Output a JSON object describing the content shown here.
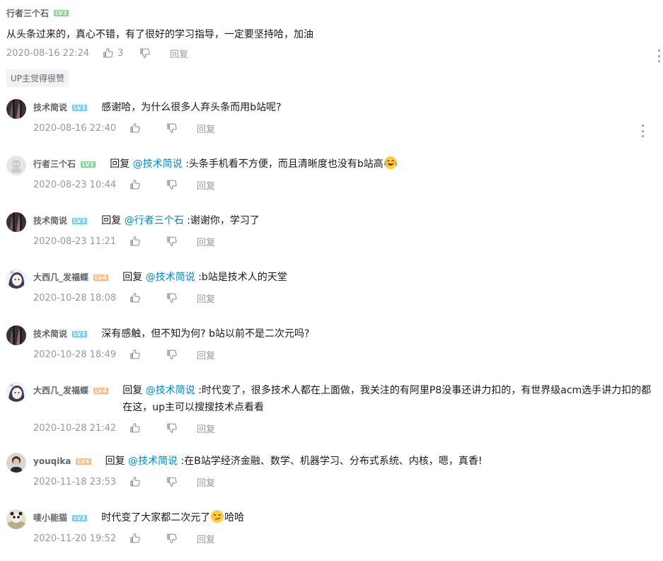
{
  "main_comment": {
    "user": "行者三个石",
    "level": "LV2",
    "text": "从头条过来的，真心不错，有了很好的学习指导，一定要坚持哈，加油",
    "time": "2020-08-16 22:24",
    "likes": "3",
    "reply_label": "回复",
    "tag": "UP主觉得很赞"
  },
  "replies": [
    {
      "user": "技术简说",
      "level": "LV3",
      "prefix": "",
      "at": "",
      "colon": "",
      "text": "感谢哈，为什么很多人弃头条而用b站呢?",
      "time": "2020-08-16 22:40",
      "reply_label": "回复",
      "avatar": "dark"
    },
    {
      "user": "行者三个石",
      "level": "LV2",
      "prefix": "回复",
      "at": "@技术简说",
      "colon": ":",
      "text": "头条手机看不方便，而且清晰度也没有b站高",
      "time": "2020-08-23 10:44",
      "reply_label": "回复",
      "avatar": "default",
      "emoji": "laughing-tears"
    },
    {
      "user": "技术简说",
      "level": "LV3",
      "prefix": "回复",
      "at": "@行者三个石",
      "colon": ":",
      "text": "谢谢你，学习了",
      "time": "2020-08-23 11:21",
      "reply_label": "回复",
      "avatar": "dark"
    },
    {
      "user": "大西几_发福蝶",
      "level": "LV4",
      "prefix": "回复",
      "at": "@技术简说",
      "colon": ":",
      "text": "b站是技术人的天堂",
      "time": "2020-10-28 18:08",
      "reply_label": "回复",
      "avatar": "anime"
    },
    {
      "user": "技术简说",
      "level": "LV3",
      "prefix": "",
      "at": "",
      "colon": "",
      "text": "深有感触，但不知为何? b站以前不是二次元吗?",
      "time": "2020-10-28 18:49",
      "reply_label": "回复",
      "avatar": "dark"
    },
    {
      "user": "大西几_发福蝶",
      "level": "LV4",
      "prefix": "回复",
      "at": "@技术简说",
      "colon": ":",
      "text": "时代变了，很多技术人都在上面做，我关注的有阿里P8没事还讲力扣的，有世界级acm选手讲力扣的都在这，up主可以搜搜技术点看看",
      "time": "2020-10-28 21:42",
      "reply_label": "回复",
      "avatar": "anime"
    },
    {
      "user": "youqika",
      "level": "LV4",
      "prefix": "回复",
      "at": "@技术简说",
      "colon": ":",
      "text": "在B站学经济金融、数学、机器学习、分布式系统、内核，嗯，真香!",
      "time": "2020-11-18 23:53",
      "reply_label": "回复",
      "avatar": "photo"
    },
    {
      "user": "唛小能猫",
      "level": "LV3",
      "prefix": "",
      "at": "",
      "colon": "",
      "text": "时代变了大家都二次元了",
      "text_after": "哈哈",
      "time": "2020-11-20 19:52",
      "reply_label": "回复",
      "avatar": "panda",
      "emoji": "smirk"
    }
  ],
  "icons": {
    "like": "thumb-up-icon",
    "dislike": "thumb-down-icon",
    "more": "more-dots-icon"
  },
  "colors": {
    "accent_link": "#008ac5",
    "muted": "#9499a0",
    "lv2": "#8bd29b",
    "lv3": "#7bcdef",
    "lv4": "#febb8b"
  }
}
